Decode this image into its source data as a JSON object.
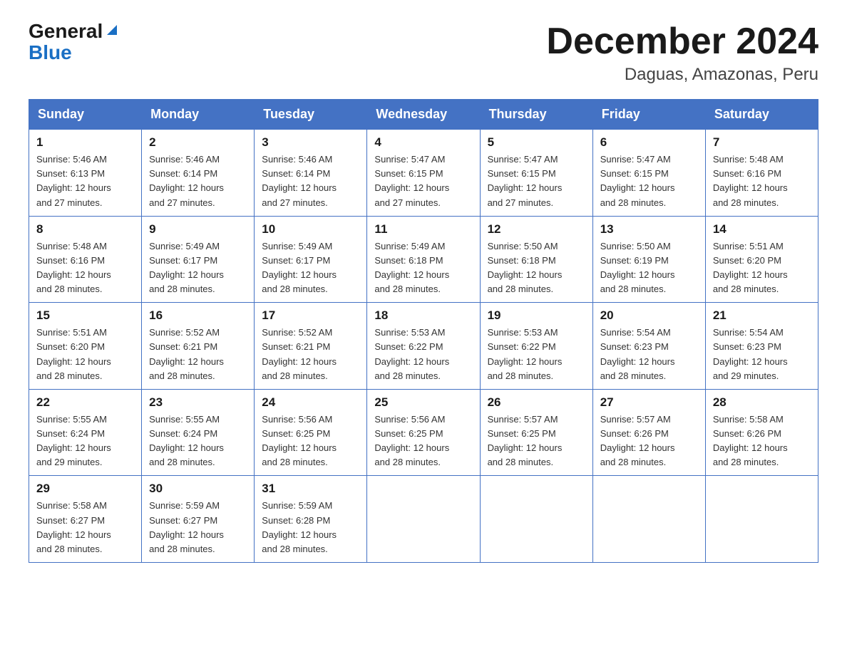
{
  "logo": {
    "general": "General",
    "blue": "Blue"
  },
  "title": {
    "month_year": "December 2024",
    "location": "Daguas, Amazonas, Peru"
  },
  "headers": [
    "Sunday",
    "Monday",
    "Tuesday",
    "Wednesday",
    "Thursday",
    "Friday",
    "Saturday"
  ],
  "weeks": [
    [
      {
        "day": "1",
        "sunrise": "5:46 AM",
        "sunset": "6:13 PM",
        "daylight": "12 hours and 27 minutes."
      },
      {
        "day": "2",
        "sunrise": "5:46 AM",
        "sunset": "6:14 PM",
        "daylight": "12 hours and 27 minutes."
      },
      {
        "day": "3",
        "sunrise": "5:46 AM",
        "sunset": "6:14 PM",
        "daylight": "12 hours and 27 minutes."
      },
      {
        "day": "4",
        "sunrise": "5:47 AM",
        "sunset": "6:15 PM",
        "daylight": "12 hours and 27 minutes."
      },
      {
        "day": "5",
        "sunrise": "5:47 AM",
        "sunset": "6:15 PM",
        "daylight": "12 hours and 27 minutes."
      },
      {
        "day": "6",
        "sunrise": "5:47 AM",
        "sunset": "6:15 PM",
        "daylight": "12 hours and 28 minutes."
      },
      {
        "day": "7",
        "sunrise": "5:48 AM",
        "sunset": "6:16 PM",
        "daylight": "12 hours and 28 minutes."
      }
    ],
    [
      {
        "day": "8",
        "sunrise": "5:48 AM",
        "sunset": "6:16 PM",
        "daylight": "12 hours and 28 minutes."
      },
      {
        "day": "9",
        "sunrise": "5:49 AM",
        "sunset": "6:17 PM",
        "daylight": "12 hours and 28 minutes."
      },
      {
        "day": "10",
        "sunrise": "5:49 AM",
        "sunset": "6:17 PM",
        "daylight": "12 hours and 28 minutes."
      },
      {
        "day": "11",
        "sunrise": "5:49 AM",
        "sunset": "6:18 PM",
        "daylight": "12 hours and 28 minutes."
      },
      {
        "day": "12",
        "sunrise": "5:50 AM",
        "sunset": "6:18 PM",
        "daylight": "12 hours and 28 minutes."
      },
      {
        "day": "13",
        "sunrise": "5:50 AM",
        "sunset": "6:19 PM",
        "daylight": "12 hours and 28 minutes."
      },
      {
        "day": "14",
        "sunrise": "5:51 AM",
        "sunset": "6:20 PM",
        "daylight": "12 hours and 28 minutes."
      }
    ],
    [
      {
        "day": "15",
        "sunrise": "5:51 AM",
        "sunset": "6:20 PM",
        "daylight": "12 hours and 28 minutes."
      },
      {
        "day": "16",
        "sunrise": "5:52 AM",
        "sunset": "6:21 PM",
        "daylight": "12 hours and 28 minutes."
      },
      {
        "day": "17",
        "sunrise": "5:52 AM",
        "sunset": "6:21 PM",
        "daylight": "12 hours and 28 minutes."
      },
      {
        "day": "18",
        "sunrise": "5:53 AM",
        "sunset": "6:22 PM",
        "daylight": "12 hours and 28 minutes."
      },
      {
        "day": "19",
        "sunrise": "5:53 AM",
        "sunset": "6:22 PM",
        "daylight": "12 hours and 28 minutes."
      },
      {
        "day": "20",
        "sunrise": "5:54 AM",
        "sunset": "6:23 PM",
        "daylight": "12 hours and 28 minutes."
      },
      {
        "day": "21",
        "sunrise": "5:54 AM",
        "sunset": "6:23 PM",
        "daylight": "12 hours and 29 minutes."
      }
    ],
    [
      {
        "day": "22",
        "sunrise": "5:55 AM",
        "sunset": "6:24 PM",
        "daylight": "12 hours and 29 minutes."
      },
      {
        "day": "23",
        "sunrise": "5:55 AM",
        "sunset": "6:24 PM",
        "daylight": "12 hours and 28 minutes."
      },
      {
        "day": "24",
        "sunrise": "5:56 AM",
        "sunset": "6:25 PM",
        "daylight": "12 hours and 28 minutes."
      },
      {
        "day": "25",
        "sunrise": "5:56 AM",
        "sunset": "6:25 PM",
        "daylight": "12 hours and 28 minutes."
      },
      {
        "day": "26",
        "sunrise": "5:57 AM",
        "sunset": "6:25 PM",
        "daylight": "12 hours and 28 minutes."
      },
      {
        "day": "27",
        "sunrise": "5:57 AM",
        "sunset": "6:26 PM",
        "daylight": "12 hours and 28 minutes."
      },
      {
        "day": "28",
        "sunrise": "5:58 AM",
        "sunset": "6:26 PM",
        "daylight": "12 hours and 28 minutes."
      }
    ],
    [
      {
        "day": "29",
        "sunrise": "5:58 AM",
        "sunset": "6:27 PM",
        "daylight": "12 hours and 28 minutes."
      },
      {
        "day": "30",
        "sunrise": "5:59 AM",
        "sunset": "6:27 PM",
        "daylight": "12 hours and 28 minutes."
      },
      {
        "day": "31",
        "sunrise": "5:59 AM",
        "sunset": "6:28 PM",
        "daylight": "12 hours and 28 minutes."
      },
      null,
      null,
      null,
      null
    ]
  ],
  "labels": {
    "sunrise": "Sunrise:",
    "sunset": "Sunset:",
    "daylight": "Daylight:"
  }
}
